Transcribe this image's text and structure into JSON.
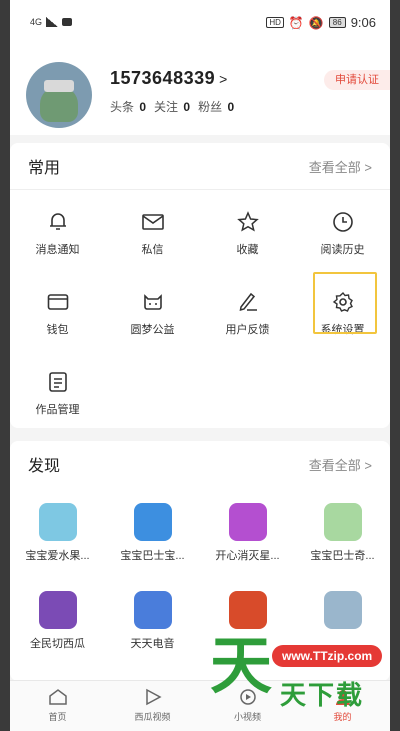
{
  "status_bar": {
    "network": "4G",
    "battery": "86",
    "time": "9:06",
    "hd": "HD"
  },
  "profile": {
    "username": "1573648339",
    "chevron": ">",
    "stats": [
      {
        "label": "头条",
        "value": "0"
      },
      {
        "label": "关注",
        "value": "0"
      },
      {
        "label": "粉丝",
        "value": "0"
      }
    ],
    "cert_button": "申请认证"
  },
  "common": {
    "title": "常用",
    "see_all": "查看全部 >",
    "items": [
      {
        "label": "消息通知",
        "icon": "bell-icon"
      },
      {
        "label": "私信",
        "icon": "mail-icon"
      },
      {
        "label": "收藏",
        "icon": "star-icon"
      },
      {
        "label": "阅读历史",
        "icon": "clock-icon"
      },
      {
        "label": "钱包",
        "icon": "wallet-icon"
      },
      {
        "label": "圆梦公益",
        "icon": "charity-icon"
      },
      {
        "label": "用户反馈",
        "icon": "pen-icon"
      },
      {
        "label": "系统设置",
        "icon": "gear-icon"
      },
      {
        "label": "作品管理",
        "icon": "document-icon"
      }
    ]
  },
  "discover": {
    "title": "发现",
    "see_all": "查看全部 >",
    "apps": [
      {
        "label": "宝宝爱水果...",
        "color": "#7ec8e3"
      },
      {
        "label": "宝宝巴士宝...",
        "color": "#3d8fe0"
      },
      {
        "label": "开心消灭星...",
        "color": "#b44fd0"
      },
      {
        "label": "宝宝巴士奇...",
        "color": "#a8d8a0"
      },
      {
        "label": "全民切西瓜",
        "color": "#7b4bb5"
      },
      {
        "label": "天天电音",
        "color": "#4a7ddb"
      },
      {
        "label": "",
        "color": "#d84b2a"
      },
      {
        "label": "",
        "color": "#9ab6cc"
      }
    ]
  },
  "nav": [
    {
      "label": "首页",
      "icon": "home-icon",
      "active": false
    },
    {
      "label": "西瓜视频",
      "icon": "play-icon",
      "active": false
    },
    {
      "label": "小视频",
      "icon": "video-icon",
      "active": false
    },
    {
      "label": "我的",
      "icon": "user-icon",
      "active": true
    }
  ],
  "watermark": {
    "url": "www.TTzip.com",
    "big": "天",
    "small": "天下载"
  }
}
